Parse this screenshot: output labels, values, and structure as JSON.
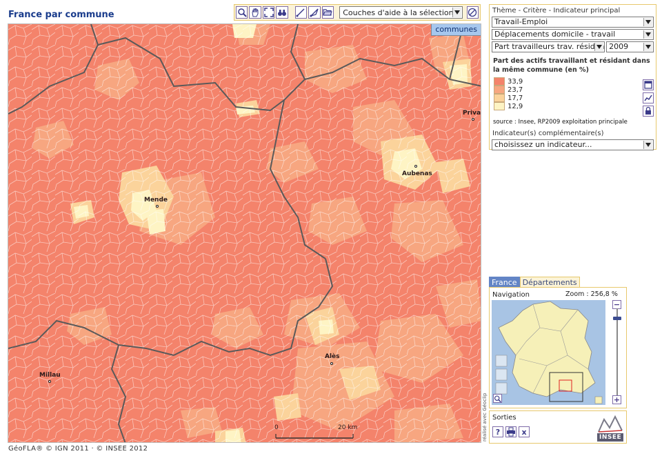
{
  "page": {
    "title": "France par commune"
  },
  "toolbar": {
    "tools": [
      "zoom-in-icon",
      "pan-hand-icon",
      "full-extent-icon",
      "binoculars-icon",
      "measure-line-icon",
      "measure-area-icon",
      "folder-open-icon"
    ],
    "layer_select": "Couches d'aide à la sélection...",
    "clear_icon": "no-entry-icon"
  },
  "map": {
    "layer_tag": "communes",
    "cities": [
      {
        "name": "Mende"
      },
      {
        "name": "Aubenas"
      },
      {
        "name": "Priva"
      },
      {
        "name": "Alès"
      },
      {
        "name": "Millau"
      }
    ],
    "scale": {
      "start": "0",
      "end": "20 km"
    },
    "side_credit": "réalisé avec Géoclip",
    "colors": {
      "high": "#f4836b",
      "mid_high": "#f7a680",
      "mid_low": "#fbd39b",
      "low": "#fef4c4",
      "border": "#5a5a5a"
    }
  },
  "footer": "GéoFLA® © IGN 2011 · © INSEE 2012",
  "panel": {
    "header": "Thème - Critère - Indicateur principal",
    "theme": "Travail-Emploi",
    "criterion": "Déplacements domicile - travail",
    "indicator": "Part travailleurs trav. résidant m",
    "year": "2009",
    "legend_title": "Part des actifs travaillant et résidant dans la même commune (en %)",
    "legend": [
      {
        "label": "33,9",
        "color": "#f4836b"
      },
      {
        "label": "23,7",
        "color": "#f7a680"
      },
      {
        "label": "17,7",
        "color": "#fbd39b"
      },
      {
        "label": "12,9",
        "color": "#fef4c4"
      }
    ],
    "source": "source : Insee, RP2009 exploitation principale",
    "complementary_label": "Indicateur(s) complémentaire(s)",
    "complementary_select": "choisissez un indicateur...",
    "side_icons": [
      "window-icon",
      "chart-icon",
      "lock-icon"
    ]
  },
  "nav": {
    "tabs": [
      "France",
      "Départements"
    ],
    "label": "Navigation",
    "zoom": "Zoom : 256,8 %",
    "minus": "−",
    "plus": "+"
  },
  "sorties": {
    "label": "Sorties",
    "buttons": [
      "help-icon",
      "print-icon",
      "close-icon"
    ],
    "help": "?",
    "close": "x",
    "logo": "INSEE"
  }
}
